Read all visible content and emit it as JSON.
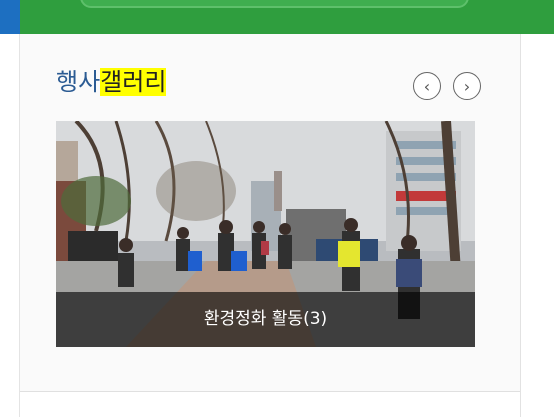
{
  "gallery": {
    "title_prefix": "행사",
    "title_highlight": "갤러리",
    "prev_label": "‹",
    "next_label": "›",
    "slide": {
      "caption": "환경정화 활동(3)"
    }
  },
  "colors": {
    "header_green": "#2f9e3e",
    "title_blue": "#2b5b93",
    "highlight": "#ffff00"
  }
}
